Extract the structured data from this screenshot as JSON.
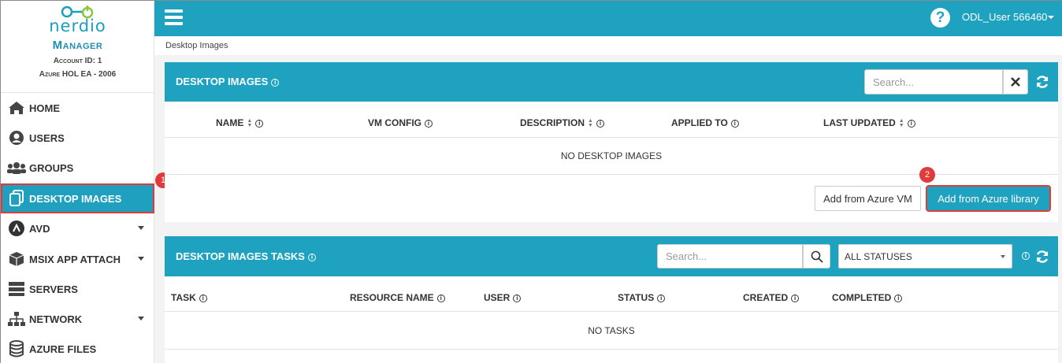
{
  "sidebar": {
    "brand": "nerdio",
    "product": "Manager",
    "account": "Account ID: 1",
    "tenant": "Azure HOL EA - 2006",
    "items": [
      {
        "label": "HOME",
        "icon": "home-icon"
      },
      {
        "label": "USERS",
        "icon": "user-circle-icon"
      },
      {
        "label": "GROUPS",
        "icon": "users-group-icon"
      },
      {
        "label": "DESKTOP IMAGES",
        "icon": "copy-files-icon",
        "active": true
      },
      {
        "label": "AVD",
        "icon": "avd-icon"
      },
      {
        "label": "MSIX APP ATTACH",
        "icon": "package-icon"
      },
      {
        "label": "SERVERS",
        "icon": "server-icon"
      },
      {
        "label": "NETWORK",
        "icon": "network-icon"
      },
      {
        "label": "AZURE FILES",
        "icon": "database-icon"
      }
    ]
  },
  "topbar": {
    "help": "?",
    "user": "ODL_User 566460"
  },
  "breadcrumb": "Desktop Images",
  "images_panel": {
    "title": "DESKTOP IMAGES",
    "search_placeholder": "Search...",
    "columns": [
      "NAME",
      "VM CONFIG",
      "DESCRIPTION",
      "APPLIED TO",
      "LAST UPDATED"
    ],
    "empty": "NO DESKTOP IMAGES",
    "add_vm": "Add from Azure VM",
    "add_library": "Add from Azure library"
  },
  "tasks_panel": {
    "title": "DESKTOP IMAGES TASKS",
    "search_placeholder": "Search...",
    "status_filter": "ALL STATUSES",
    "columns": [
      "TASK",
      "RESOURCE NAME",
      "USER",
      "STATUS",
      "CREATED",
      "COMPLETED"
    ],
    "empty": "NO TASKS"
  },
  "annotations": {
    "step1": "1",
    "step2": "2"
  },
  "colors": {
    "accent": "#1ea2c0",
    "highlight": "#e03a3a"
  }
}
